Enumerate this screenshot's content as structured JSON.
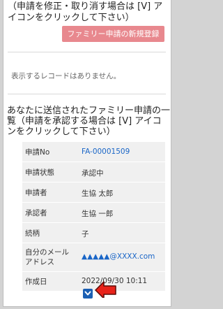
{
  "top_note": "（申請を修正・取り消す場合は [V] アイコンをクリックして下さい）",
  "new_button_label": "ファミリー申請の新規登録",
  "empty_message": "表示するレコードはありません。",
  "section_heading": "あなたに送信されたファミリー申請の一覧（申請を承認する場合は [V] アイコンをクリックして下さい）",
  "record": {
    "rows": [
      {
        "label": "申請No",
        "value": "FA-00001509"
      },
      {
        "label": "申請状態",
        "value": "承認中"
      },
      {
        "label": "申請者",
        "value": "生協 太郎"
      },
      {
        "label": "承認者",
        "value": "生協 一郎"
      },
      {
        "label": "続柄",
        "value": "子"
      },
      {
        "label": "自分のメールアドレス",
        "value": "▲▲▲▲▲@XXXX.com"
      },
      {
        "label": "作成日",
        "value": "2022/09/30 10:11"
      }
    ]
  },
  "colors": {
    "button_bg": "#e8888e",
    "link": "#1a66c7",
    "card_bg": "#f0f0f0",
    "icon_btn": "#1b5fb3",
    "arrow": "#e8231a"
  }
}
